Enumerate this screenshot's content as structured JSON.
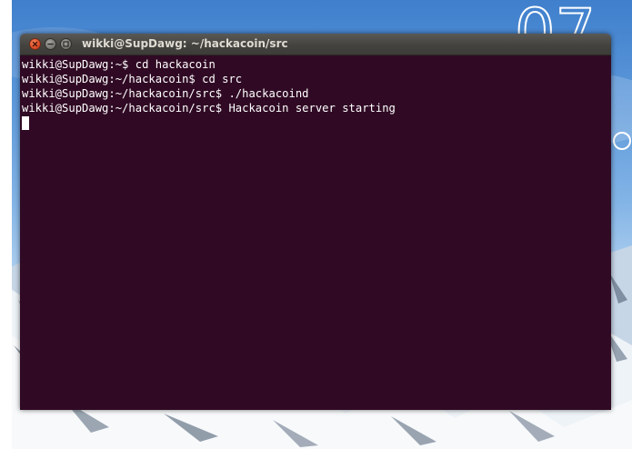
{
  "desktop": {
    "wallpaper": "snowy-mountains-blue-sky",
    "clock_fragment": "07"
  },
  "window": {
    "title": "wikki@SupDawg: ~/hackacoin/src",
    "buttons": {
      "close": "close-icon",
      "minimize": "minimize-icon",
      "maximize": "maximize-icon"
    }
  },
  "terminal": {
    "background": "#300a24",
    "foreground": "#ffffff",
    "lines": [
      "wikki@SupDawg:~$ cd hackacoin",
      "wikki@SupDawg:~/hackacoin$ cd src",
      "wikki@SupDawg:~/hackacoin/src$ ./hackacoind",
      "wikki@SupDawg:~/hackacoin/src$ Hackacoin server starting"
    ]
  }
}
